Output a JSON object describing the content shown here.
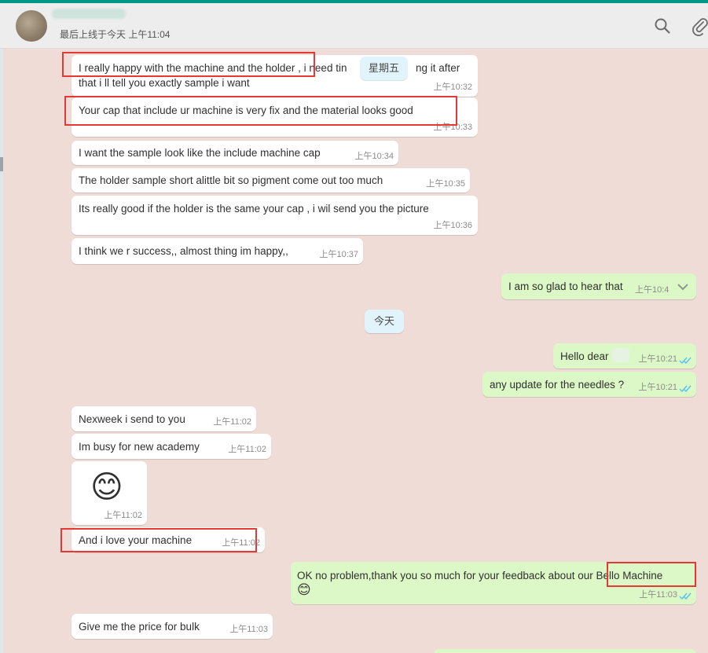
{
  "header": {
    "contact_name": "",
    "last_seen": "最后上线于今天 上午11:04"
  },
  "date_chips": {
    "friday": "星期五",
    "today": "今天"
  },
  "messages": [
    {
      "dir": "in",
      "text": "I really happy with the machine and the holder , i need tin",
      "text2": "ng it after",
      "line2": "that i ll tell you exactly sample i want",
      "time": "上午10:32"
    },
    {
      "dir": "in",
      "text": "Your cap that include ur machine is very fix and the material looks good",
      "time": "上午10:33"
    },
    {
      "dir": "in",
      "text": "I want the sample look like the include machine cap",
      "time": "上午10:34"
    },
    {
      "dir": "in",
      "text": "The holder sample short alittle bit so pigment come out too much",
      "time": "上午10:35"
    },
    {
      "dir": "in",
      "text": "Its really good if the holder is the same your cap , i wil send you the picture",
      "time": "上午10:36"
    },
    {
      "dir": "in",
      "text": "I think we r success,, almost thing im happy,,",
      "time": "上午10:37"
    },
    {
      "dir": "out",
      "text": "I am so glad to hear that",
      "time": "上午10:4"
    },
    {
      "dir": "out",
      "text": "Hello dear",
      "time": "上午10:21"
    },
    {
      "dir": "out",
      "text": "any update for the needles ?",
      "time": "上午10:21"
    },
    {
      "dir": "in",
      "text": "Nexweek i send to you",
      "time": "上午11:02"
    },
    {
      "dir": "in",
      "text": "Im busy for new academy",
      "time": "上午11:02"
    },
    {
      "dir": "in",
      "text": "😊",
      "time": "上午11:02"
    },
    {
      "dir": "in",
      "text": "And i love your machine",
      "time": "上午11:02"
    },
    {
      "dir": "out",
      "text": "OK no problem,thank you so much for your feedback about our Bello Machine",
      "line2": "😊",
      "time": "上午11:03"
    },
    {
      "dir": "in",
      "text": "Give me the price for bulk",
      "time": "上午11:03"
    }
  ],
  "colors": {
    "accent": "#009688",
    "chat_bg": "#efdcd6",
    "incoming": "#ffffff",
    "outgoing": "#dcf8c6",
    "read_ticks": "#4fc3f7",
    "highlight": "#e53935"
  },
  "icons": {
    "search": "search-icon",
    "attach": "paperclip-icon",
    "ticks": "double-check-icon",
    "chevron": "chevron-down-icon"
  }
}
